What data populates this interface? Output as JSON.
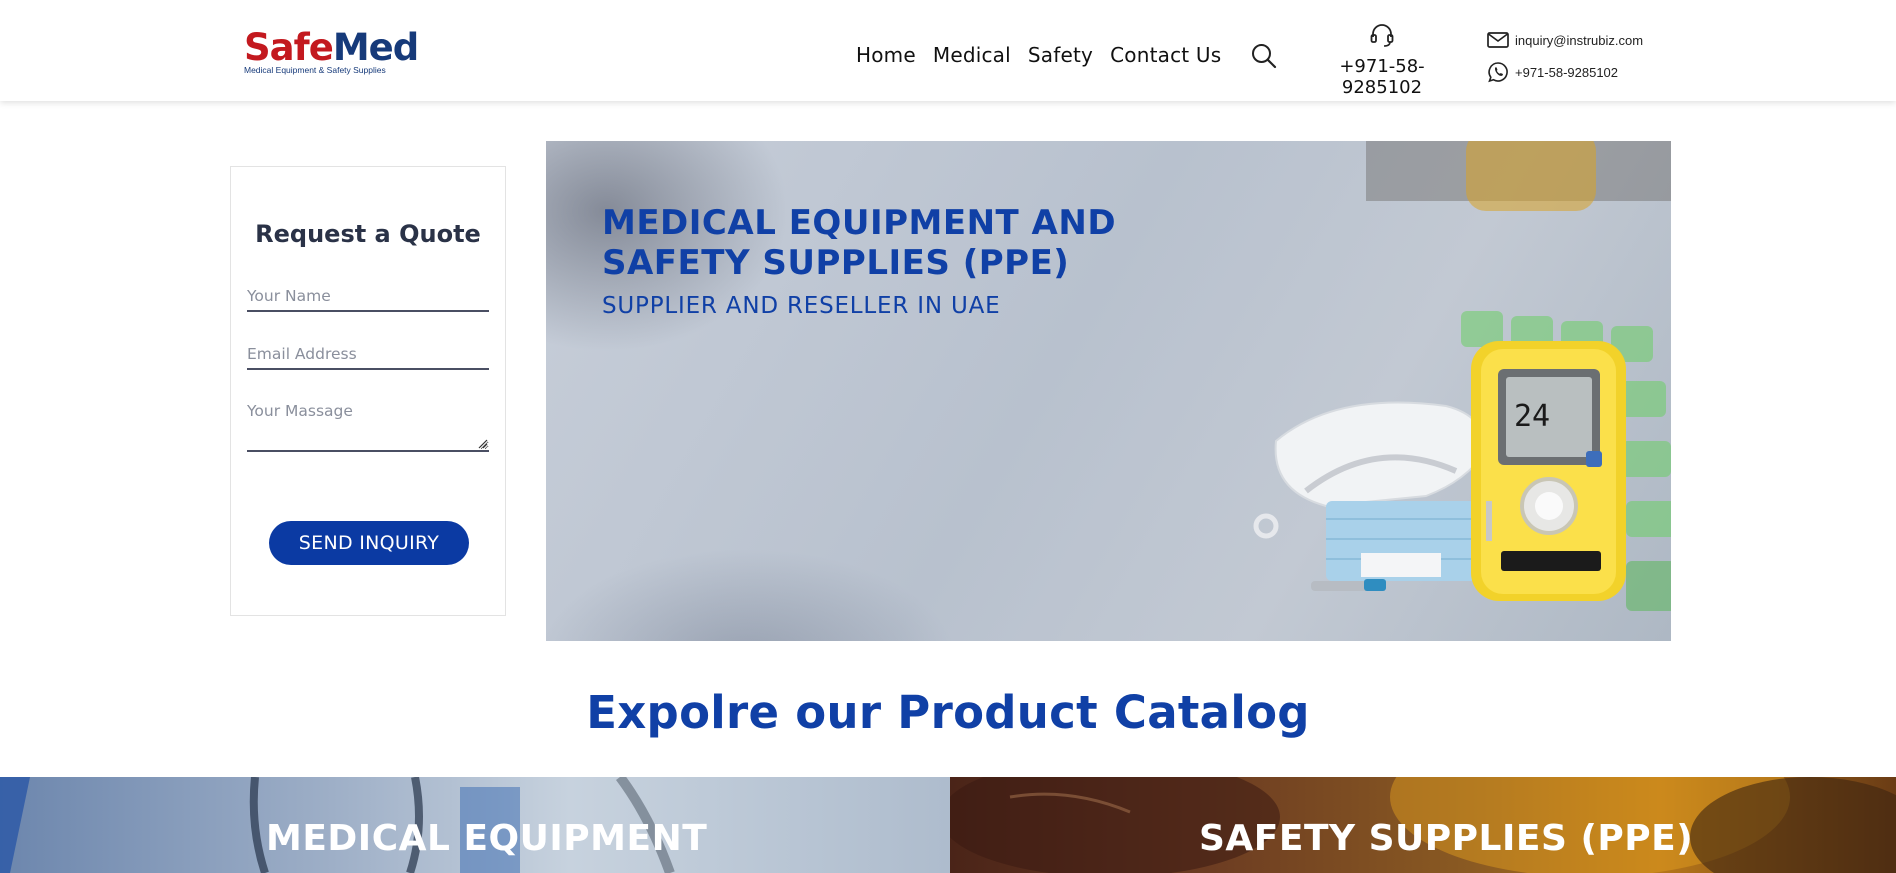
{
  "header": {
    "logo": {
      "part1": "Safe",
      "part2": "Med",
      "tagline": "Medical Equipment & Safety Supplies"
    },
    "nav": [
      {
        "label": "Home"
      },
      {
        "label": "Medical"
      },
      {
        "label": "Safety"
      },
      {
        "label": "Contact Us"
      }
    ],
    "icons": {
      "search": "search-icon",
      "headset": "headset-icon",
      "mail": "mail-icon",
      "whatsapp": "whatsapp-icon"
    },
    "phone": "+971-58-9285102",
    "email": "inquiry@instrubiz.com",
    "whatsapp": "+971-58-9285102"
  },
  "quote_form": {
    "title": "Request a Quote",
    "name_placeholder": "Your Name",
    "email_placeholder": "Email Address",
    "message_placeholder": "Your Massage",
    "submit_label": "SEND INQUIRY"
  },
  "hero": {
    "title_line1": "MEDICAL EQUIPMENT AND",
    "title_line2": "SAFETY SUPPLIES (PPE)",
    "subtitle": "SUPPLIER AND RESELLER IN UAE",
    "gas_detector_reading": "24"
  },
  "catalog": {
    "title": "Expolre our Product Catalog",
    "tiles": [
      {
        "label": "MEDICAL EQUIPMENT"
      },
      {
        "label": "SAFETY SUPPLIES (PPE)"
      }
    ]
  },
  "colors": {
    "brand_blue": "#1040a6",
    "button_blue": "#0b3aa3",
    "logo_red": "#c3191f",
    "logo_navy": "#163a7a"
  }
}
